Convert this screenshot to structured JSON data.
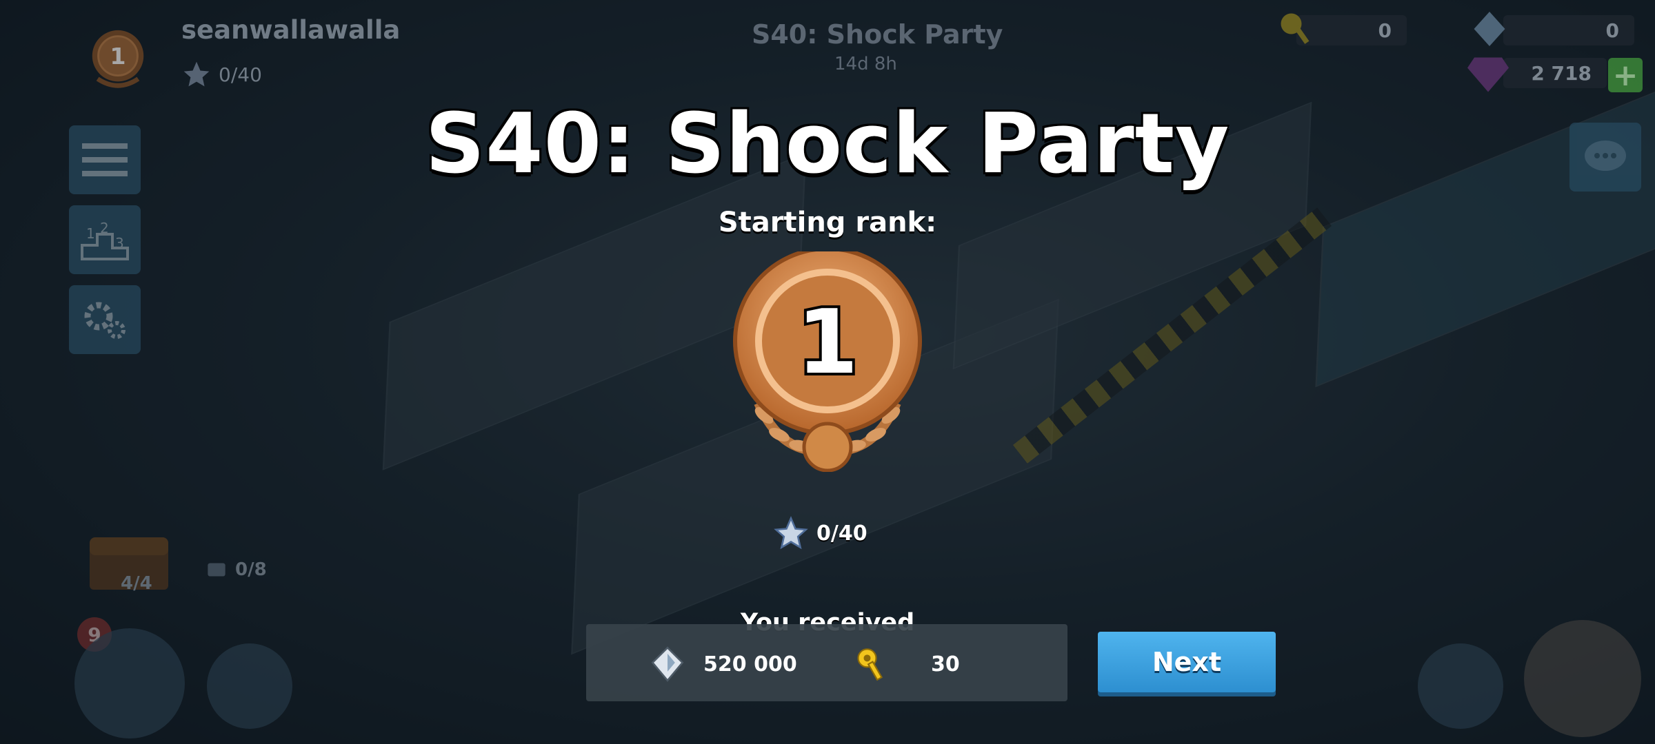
{
  "hud": {
    "player_name": "seanwallawalla",
    "player_rank": "1",
    "player_stars": "0/40",
    "season_title": "S40: Shock Party",
    "season_time": "14d 8h",
    "key_count": "0",
    "intel_count": "0",
    "diamond_count": "2 718",
    "plus_label": "+",
    "chest_count": "4/4",
    "parts_count": "0/8",
    "notification_badge": "9"
  },
  "modal": {
    "title": "S40: Shock Party",
    "subtitle": "Starting rank:",
    "rank": "1",
    "stars": "0/40",
    "received_label": "You received",
    "rewards": [
      {
        "icon": "intel-icon",
        "amount": "520 000"
      },
      {
        "icon": "key-icon",
        "amount": "30"
      }
    ],
    "next_label": "Next"
  },
  "colors": {
    "medal_bronze": "#c57a3e",
    "next_button": "#3aa3e0",
    "key_yellow": "#f2c51d"
  }
}
